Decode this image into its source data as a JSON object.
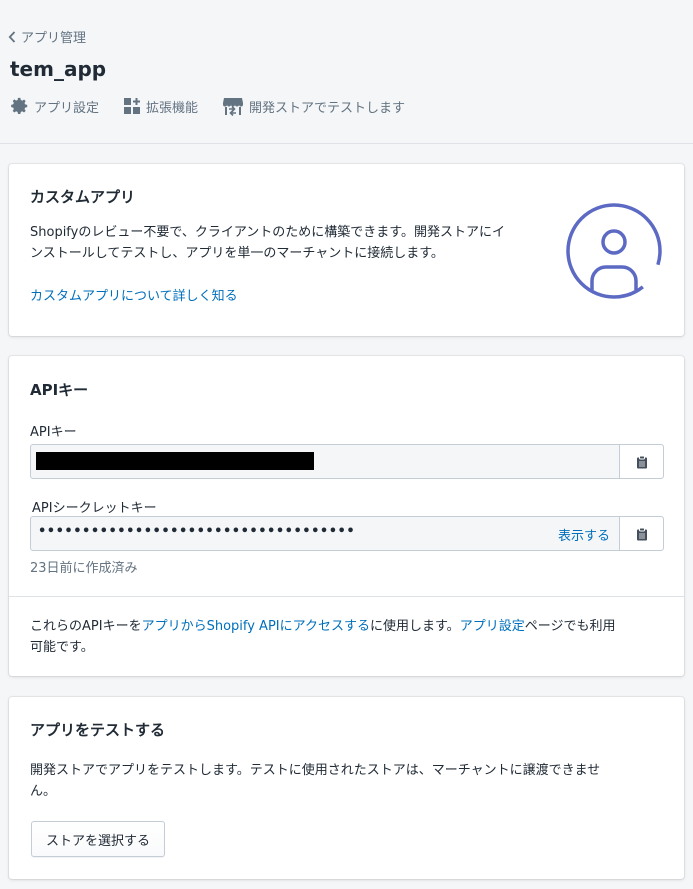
{
  "header": {
    "breadcrumb": "アプリ管理",
    "title": "tem_app",
    "actions": [
      {
        "label": "アプリ設定",
        "icon": "gear-icon"
      },
      {
        "label": "拡張機能",
        "icon": "apps-icon"
      },
      {
        "label": "開発ストアでテストします",
        "icon": "store-icon"
      }
    ]
  },
  "custom_app": {
    "title": "カスタムアプリ",
    "description_line1": "Shopifyのレビュー不要で、クライアントのために構築できます。開発ストアにイ",
    "description_line2": "ンストールしてテストし、アプリを単一のマーチャントに接続します。",
    "learn_more": "カスタムアプリについて詳しく知る",
    "icon": "user-circle-icon"
  },
  "api": {
    "title": "APIキー",
    "api_key_label": "APIキー",
    "secret_label": "APIシークレットキー",
    "secret_masked": "••••••••••••••••••••••••••••••••••••",
    "show_label": "表示する",
    "created": "23日前に作成済み",
    "footer_pre": "これらのAPIキーを",
    "footer_link1": "アプリからShopify APIにアクセスする",
    "footer_mid": "に使用します。",
    "footer_link2": "アプリ設定",
    "footer_post": "ページでも利用",
    "footer_line2": "可能です。"
  },
  "test_app": {
    "title": "アプリをテストする",
    "description_line1": "開発ストアでアプリをテストします。テストに使用されたストアは、マーチャントに譲渡できませ",
    "description_line2": "ん。",
    "button": "ストアを選択する"
  },
  "colors": {
    "link": "#006fbb",
    "accent": "#5c6ac4",
    "background": "#f4f6f8"
  }
}
